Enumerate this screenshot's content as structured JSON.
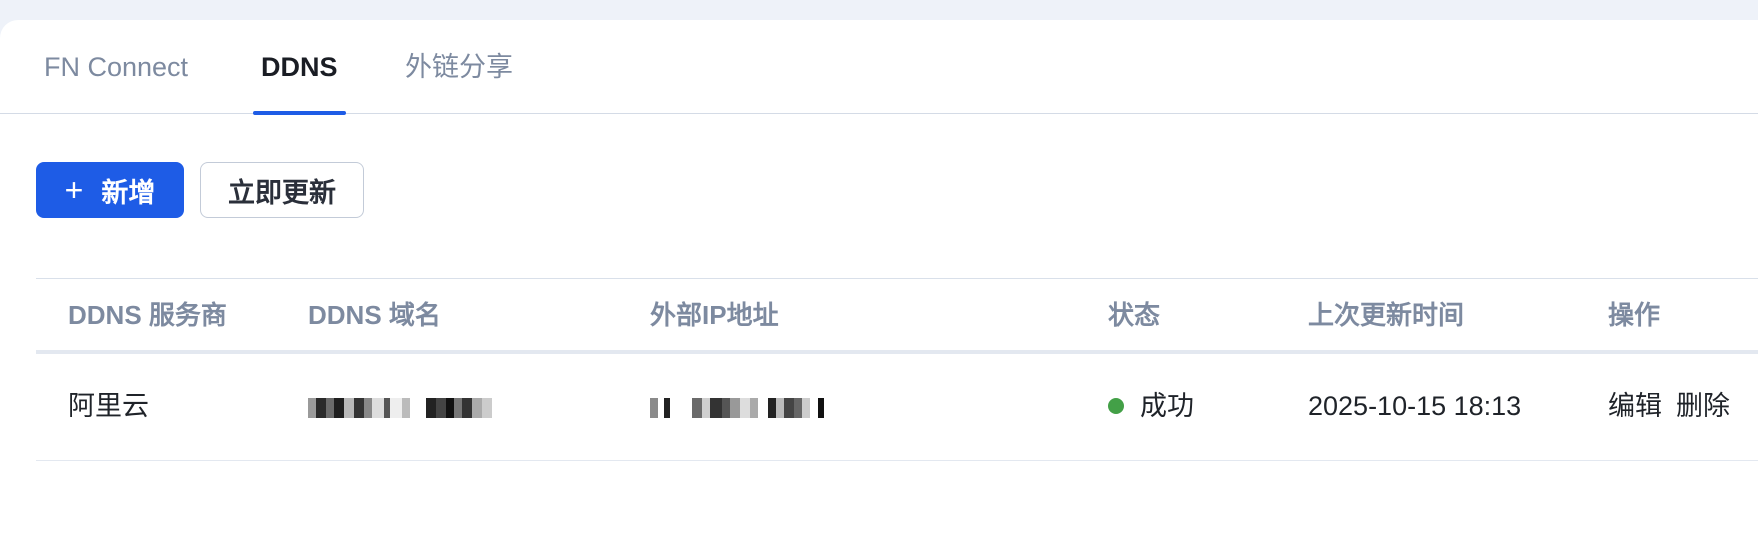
{
  "tabs": [
    {
      "label": "FN Connect",
      "active": false
    },
    {
      "label": "DDNS",
      "active": true
    },
    {
      "label": "外链分享",
      "active": false
    }
  ],
  "toolbar": {
    "add_icon": "plus-icon",
    "add_label": "新增",
    "update_label": "立即更新"
  },
  "table": {
    "columns": [
      "DDNS 服务商",
      "DDNS 域名",
      "外部IP地址",
      "状态",
      "上次更新时间",
      "操作"
    ],
    "rows": [
      {
        "provider": "阿里云",
        "domain_redacted": true,
        "ip_redacted": true,
        "status": "成功",
        "status_color": "#43a047",
        "last_update": "2025-10-15 18:13",
        "actions": [
          "编辑",
          "删除"
        ]
      }
    ]
  },
  "colors": {
    "accent": "#1e5ce6",
    "page_background": "#eef2f9",
    "header_text": "#7d8aa0"
  }
}
